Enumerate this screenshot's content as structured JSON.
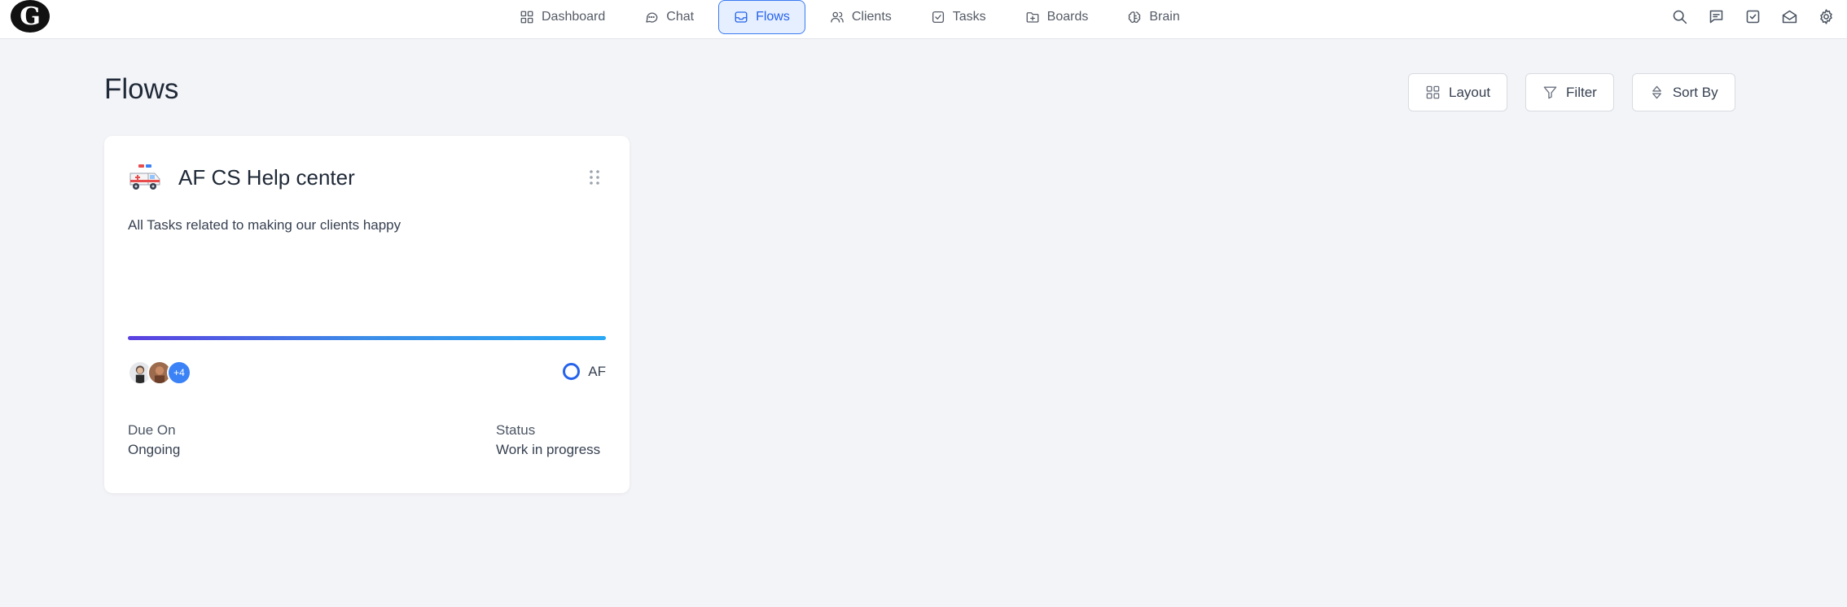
{
  "app": {
    "logo_letter": "G"
  },
  "nav": {
    "items": [
      {
        "label": "Dashboard",
        "icon": "grid-icon"
      },
      {
        "label": "Chat",
        "icon": "chat-bubble-icon"
      },
      {
        "label": "Flows",
        "icon": "inbox-icon"
      },
      {
        "label": "Clients",
        "icon": "users-icon"
      },
      {
        "label": "Tasks",
        "icon": "check-square-icon"
      },
      {
        "label": "Boards",
        "icon": "folder-plus-icon"
      },
      {
        "label": "Brain",
        "icon": "brain-icon"
      }
    ],
    "active": "Flows"
  },
  "tools": [
    "search-icon",
    "message-icon",
    "task-check-icon",
    "mail-open-icon",
    "gear-icon"
  ],
  "page": {
    "title": "Flows"
  },
  "controls": {
    "layout": "Layout",
    "filter": "Filter",
    "sort": "Sort By"
  },
  "card": {
    "emoji": "ambulance",
    "title": "AF CS Help center",
    "description": "All Tasks related to making our clients happy",
    "progress": 1.0,
    "avatars_more": "+4",
    "owner": "AF",
    "due_label": "Due On",
    "due_value": "Ongoing",
    "status_label": "Status",
    "status_value": "Work in progress"
  },
  "colors": {
    "accent": "#2563eb",
    "active_bg": "#e6efff",
    "page_bg": "#f3f4f8"
  }
}
